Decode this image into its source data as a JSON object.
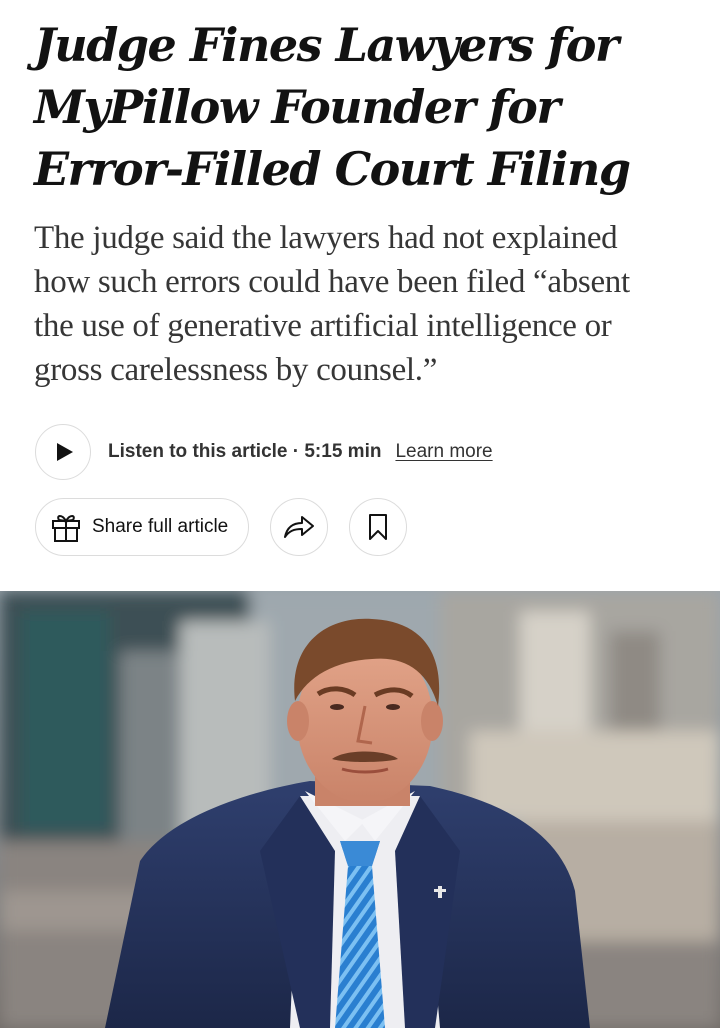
{
  "article": {
    "headline_lines": [
      "Judge Fines Lawyers for",
      "MyPillow Founder for",
      "Error-Filled Court Filing"
    ],
    "summary_lines": [
      "The judge said the lawyers had not explained",
      "how such errors could have been filed “absent",
      "the use of generative artificial intelligence or",
      "gross carelessness by counsel.”"
    ]
  },
  "audio": {
    "play_icon": "play-icon",
    "listen_label": "Listen to this article · 5:15 min",
    "learn_more_label": "Learn more"
  },
  "actions": {
    "gift_icon": "gift-icon",
    "share_full_label": "Share full article",
    "share_icon": "share-arrow-icon",
    "save_icon": "bookmark-icon"
  },
  "colors": {
    "headline": "#121212",
    "summary": "#363636",
    "button_border": "#dcdcdc"
  }
}
